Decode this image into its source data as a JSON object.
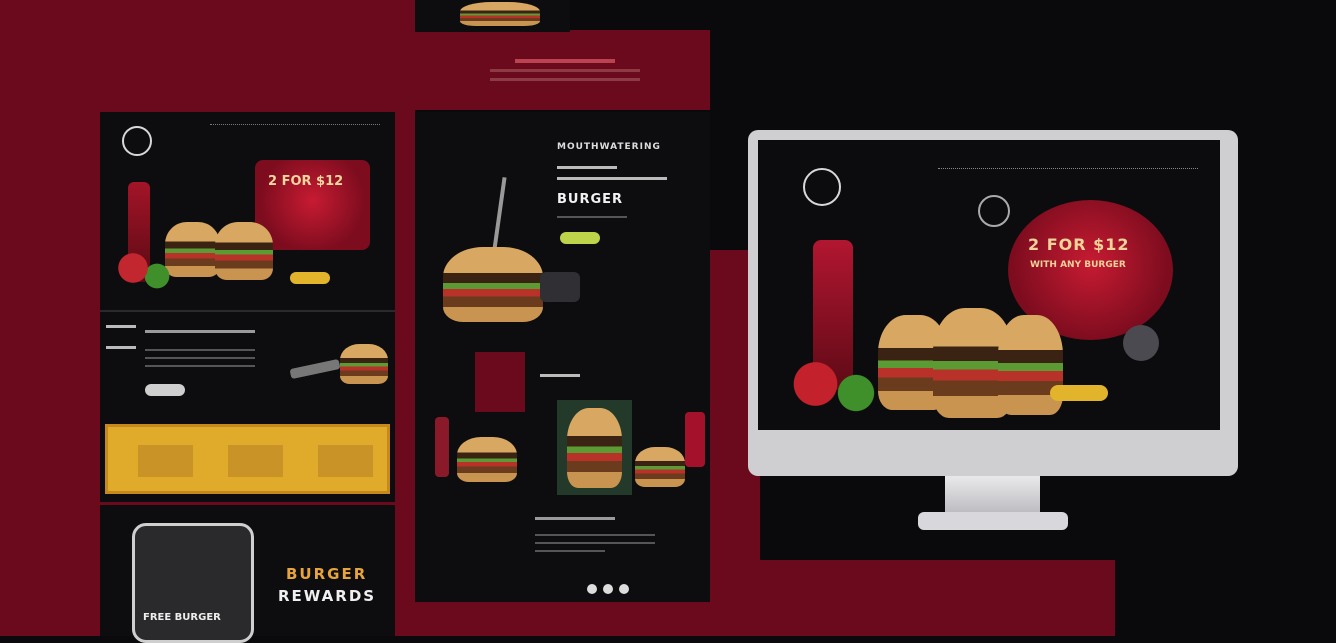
{
  "colors": {
    "bg": "#0a0a0c",
    "brand_red": "#6b0a1c",
    "accent_yellow": "#e2b42c",
    "panel": "#0d0d10"
  },
  "mobile_panel": {
    "promo": "2 FOR $12"
  },
  "middle_panel": {
    "headline_top": "MOUTHWATERING",
    "headline_bottom": "BURGER"
  },
  "bottom_left": {
    "phone_text": "FREE BURGER",
    "rewards_top": "BURGER",
    "rewards_bottom": "REWARDS"
  },
  "desktop": {
    "hero_title": "2 FOR $12",
    "hero_sub": "WITH ANY BURGER"
  }
}
